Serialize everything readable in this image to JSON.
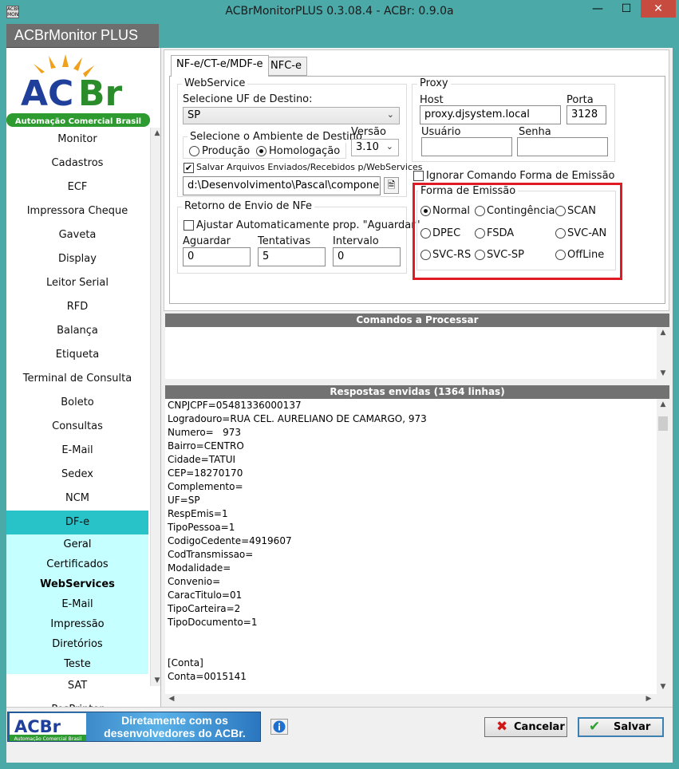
{
  "window": {
    "title": "ACBrMonitorPLUS 0.3.08.4 - ACBr: 0.9.0a",
    "icon_text": "ACBR MONITOR",
    "minimize": "—",
    "maximize": "☐",
    "close": "✕"
  },
  "header": {
    "title": "ACBrMonitor PLUS"
  },
  "logo": {
    "brand": "ACBr",
    "tagline": "Automação Comercial Brasil"
  },
  "sidebar": {
    "items_top": [
      "Monitor",
      "Cadastros",
      "ECF",
      "Impressora Cheque",
      "Gaveta",
      "Display",
      "Leitor Serial",
      "RFD",
      "Balança",
      "Etiqueta",
      "Terminal de Consulta",
      "Boleto",
      "Consultas",
      "E-Mail",
      "Sedex",
      "NCM"
    ],
    "active_group": "DF-e",
    "sub_items": [
      "Geral",
      "Certificados",
      "WebServices",
      "E-Mail",
      "Impressão",
      "Diretórios",
      "Teste"
    ],
    "active_sub": "WebServices",
    "items_bottom": [
      "SAT",
      "PosPrinter"
    ]
  },
  "tabs": [
    "NF-e/CT-e/MDF-e",
    "NFC-e"
  ],
  "webservice": {
    "group": "WebService",
    "uf_label": "Selecione UF de Destino:",
    "uf_value": "SP",
    "ambiente_label": "Selecione o Ambiente de Destino",
    "producao": "Produção",
    "homologacao": "Homologação",
    "versao_label": "Versão",
    "versao_value": "3.10",
    "salvar_label": "Salvar Arquivos Enviados/Recebidos p/WebServices",
    "path_value": "d:\\Desenvolvimento\\Pascal\\componentes"
  },
  "retorno": {
    "group": "Retorno de Envio de NFe",
    "ajustar_label": "Ajustar Automaticamente prop. \"Aguardar\"",
    "aguardar_label": "Aguardar",
    "aguardar_value": "0",
    "tentativas_label": "Tentativas",
    "tentativas_value": "5",
    "intervalo_label": "Intervalo",
    "intervalo_value": "0"
  },
  "proxy": {
    "group": "Proxy",
    "host_label": "Host",
    "host_value": "proxy.djsystem.local",
    "porta_label": "Porta",
    "porta_value": "3128",
    "usuario_label": "Usuário",
    "usuario_value": "",
    "senha_label": "Senha",
    "senha_value": ""
  },
  "ignorar_label": "Ignorar Comando Forma de Emissão",
  "forma": {
    "group": "Forma de Emissão",
    "options": [
      "Normal",
      "Contingência",
      "SCAN",
      "DPEC",
      "FSDA",
      "SVC-AN",
      "SVC-RS",
      "SVC-SP",
      "OffLine"
    ],
    "selected": "Normal"
  },
  "comandos": {
    "title": "Comandos a Processar"
  },
  "respostas": {
    "title": "Respostas envidas (1364 linhas)",
    "lines": [
      "CNPJCPF=05481336000137",
      "Logradouro=RUA CEL. AURELIANO DE CAMARGO, 973",
      "Numero=   973",
      "Bairro=CENTRO",
      "Cidade=TATUI",
      "CEP=18270170",
      "Complemento=",
      "UF=SP",
      "RespEmis=1",
      "TipoPessoa=1",
      "CodigoCedente=4919607",
      "CodTransmissao=",
      "Modalidade=",
      "Convenio=",
      "CaracTitulo=01",
      "TipoCarteira=2",
      "TipoDocumento=1",
      "",
      "",
      "[Conta]",
      "Conta=0015141"
    ]
  },
  "footer": {
    "banner_line1": "Diretamente com os",
    "banner_line2": "desenvolvedores do ACBr.",
    "banner_logo": "ACBr",
    "banner_logo_sub": "Automação Comercial Brasil",
    "cancel_label": "Cancelar",
    "save_label": "Salvar"
  }
}
